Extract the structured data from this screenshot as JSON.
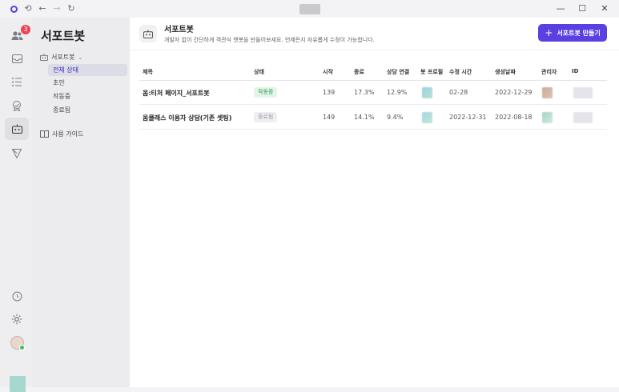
{
  "window": {
    "center_placeholder": ""
  },
  "rail": {
    "badge_count": "3",
    "items": [
      "people-icon",
      "inbox-icon",
      "list-icon",
      "badge-icon",
      "bot-icon",
      "send-icon",
      "history-icon",
      "settings-icon"
    ]
  },
  "sidebar": {
    "title": "서포트봇",
    "group_label": "서포트봇",
    "items": [
      {
        "label": "전체 상태",
        "active": true
      },
      {
        "label": "초안",
        "active": false
      },
      {
        "label": "작동중",
        "active": false
      },
      {
        "label": "종료됨",
        "active": false
      }
    ],
    "guide_label": "사용 가이드"
  },
  "header": {
    "title": "서포트봇",
    "description": "개발자 없이 간단하게 객관식 챗봇을 만들어보세요. 언제든지 자유롭게 수정이 가능합니다.",
    "create_button": "서포트봇 만들기"
  },
  "table": {
    "columns": [
      "제목",
      "상태",
      "시작",
      "종료",
      "상담 연결",
      "봇 프로필",
      "수정 시간",
      "생성날짜",
      "관리자",
      "ID"
    ],
    "rows": [
      {
        "title": "옴:티처 페이지_서포트봇",
        "status": "작동중",
        "status_type": "active",
        "start": "139",
        "end": "17.3%",
        "connect": "12.9%",
        "modified": "02-28",
        "created": "2022-12-29"
      },
      {
        "title": "옴클래스 이용자 상담(기존 셋팅)",
        "status": "종료됨",
        "status_type": "done",
        "start": "149",
        "end": "14.1%",
        "connect": "9.4%",
        "modified": "2022-12-31",
        "created": "2022-08-18"
      }
    ]
  },
  "colors": {
    "accent": "#5b3fe0",
    "badge": "#f04452",
    "status_active_bg": "#e2f5e8",
    "status_active_fg": "#2e9b55"
  }
}
